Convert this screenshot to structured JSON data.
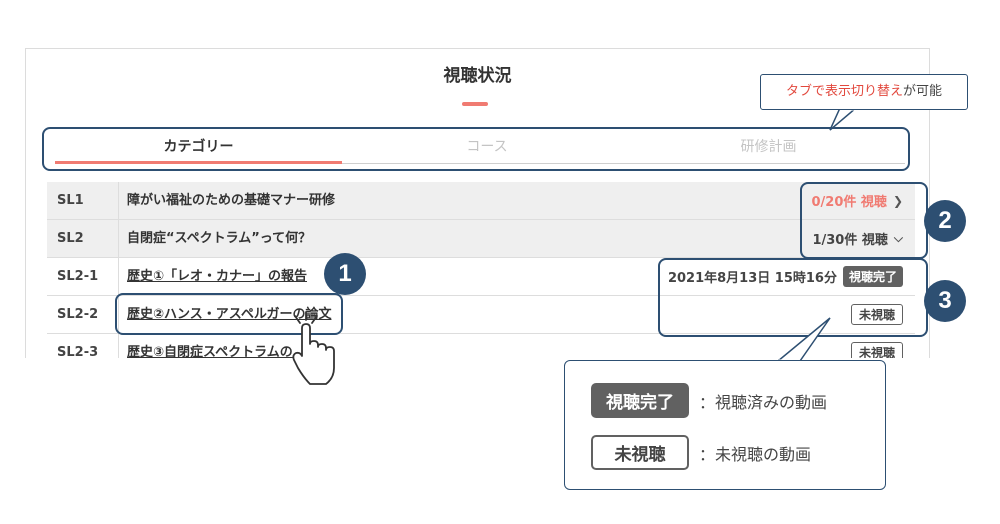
{
  "page": {
    "title": "視聴状況"
  },
  "tabs": [
    {
      "label": "カテゴリー",
      "active": true
    },
    {
      "label": "コース",
      "active": false
    },
    {
      "label": "研修計画",
      "active": false
    }
  ],
  "rows": [
    {
      "code": "SL1",
      "name": "障がい福祉のための基礎マナー研修",
      "meta": "0/20件 視聴",
      "meta_icon": "chevron-right-icon"
    },
    {
      "code": "SL2",
      "name": "自閉症“スペクトラム”って何？",
      "meta": "1/30件 視聴",
      "meta_icon": "chevron-down-icon"
    },
    {
      "code": "SL2-1",
      "name": "歴史①「レオ・カナー」の報告",
      "date": "2021年8月13日 15時16分",
      "status": "視聴完了"
    },
    {
      "code": "SL2-2",
      "name": "歴史②ハンス・アスペルガーの論文",
      "status": "未視聴"
    },
    {
      "code": "SL2-3",
      "name": "歴史③自閉症スペクトラムの",
      "status": "未視聴"
    }
  ],
  "tooltip": {
    "highlight": "タブで表示切り替え",
    "rest": "が可能"
  },
  "callouts": [
    "1",
    "2",
    "3"
  ],
  "legend": [
    {
      "badge": "視聴完了",
      "desc": "：視聴済みの動画"
    },
    {
      "badge": "未視聴",
      "desc": "：未視聴の動画"
    }
  ],
  "colors": {
    "accent": "#f07b72",
    "annotation": "#2d4f72",
    "badge": "#616161"
  }
}
